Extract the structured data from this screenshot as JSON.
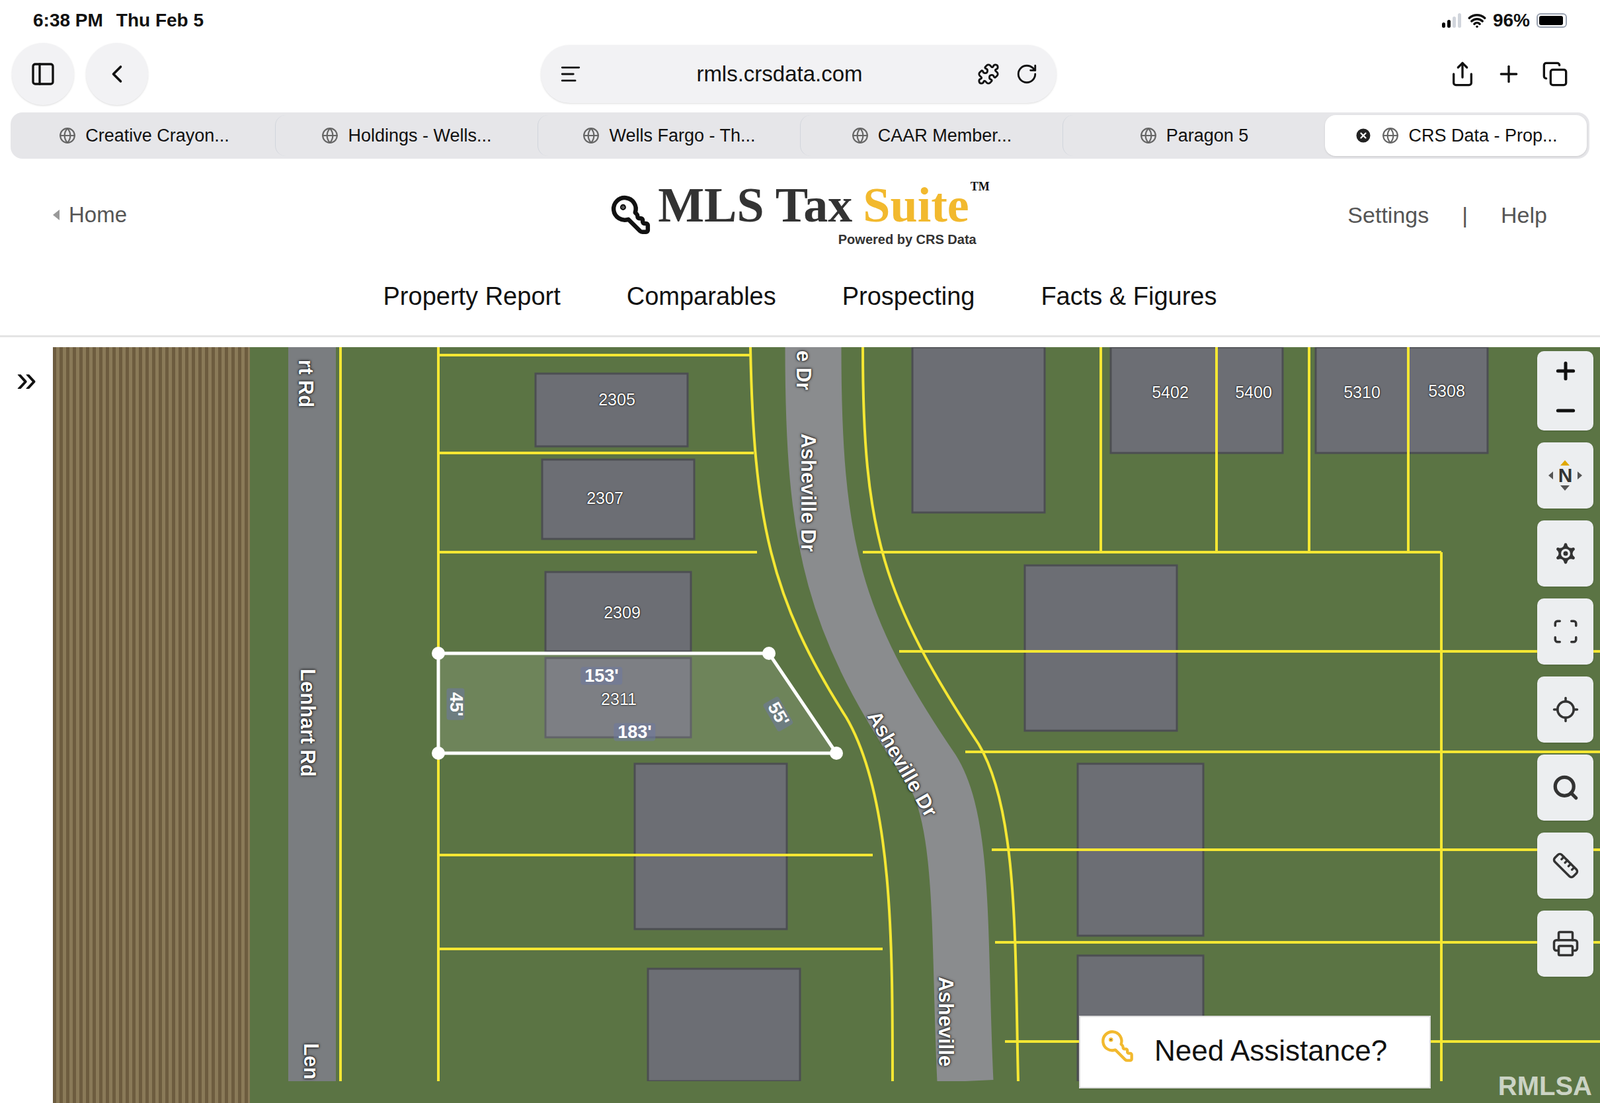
{
  "status_bar": {
    "time": "6:38 PM",
    "date": "Thu Feb 5",
    "battery": "96%",
    "battery_level": 0.96
  },
  "browser": {
    "url": "rmls.crsdata.com",
    "tabs": [
      {
        "label": "Creative Crayon...",
        "selected": false
      },
      {
        "label": "Holdings - Wells...",
        "selected": false
      },
      {
        "label": "Wells Fargo - Th...",
        "selected": false
      },
      {
        "label": "CAAR Member...",
        "selected": false
      },
      {
        "label": "Paragon 5",
        "selected": false
      },
      {
        "label": "CRS Data - Prop...",
        "selected": true
      }
    ]
  },
  "header": {
    "home": "Home",
    "logo": {
      "title_main": "MLS Tax",
      "title_accent": "Suite",
      "trademark": "TM",
      "subtitle": "Powered by CRS Data"
    },
    "links": [
      "Settings",
      "Help"
    ],
    "separator": "|"
  },
  "nav": [
    {
      "label": "Property Report"
    },
    {
      "label": "Comparables"
    },
    {
      "label": "Prospecting"
    },
    {
      "label": "Facts & Figures"
    }
  ],
  "map": {
    "expand": "»",
    "compass": "N",
    "labels": [
      {
        "text": "2305",
        "kind": "address"
      },
      {
        "text": "2307",
        "kind": "address"
      },
      {
        "text": "2309",
        "kind": "address"
      },
      {
        "text": "2311",
        "kind": "address"
      },
      {
        "text": "5402",
        "kind": "address"
      },
      {
        "text": "5400",
        "kind": "address"
      },
      {
        "text": "5310",
        "kind": "address"
      },
      {
        "text": "5308",
        "kind": "address"
      },
      {
        "text": "153'",
        "kind": "dimension"
      },
      {
        "text": "183'",
        "kind": "dimension"
      },
      {
        "text": "45'",
        "kind": "dimension"
      },
      {
        "text": "55'",
        "kind": "dimension"
      },
      {
        "text": "rt Rd",
        "kind": "street"
      },
      {
        "text": "Lenhart Rd",
        "kind": "street"
      },
      {
        "text": "Len",
        "kind": "street"
      },
      {
        "text": "e Dr",
        "kind": "street"
      },
      {
        "text": "Asheville Dr",
        "kind": "street"
      },
      {
        "text": "Asheville Dr",
        "kind": "street"
      },
      {
        "text": "Asheville",
        "kind": "street"
      }
    ],
    "assistance": "Need Assistance?",
    "watermark": "RMLSA"
  }
}
